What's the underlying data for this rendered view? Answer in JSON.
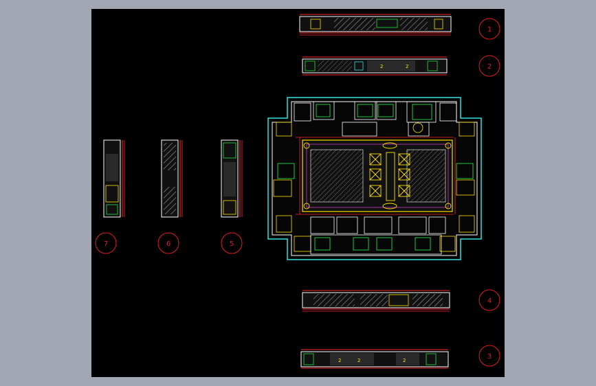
{
  "colors": {
    "background": "#a3a7b3",
    "viewport": "#000000",
    "marker": "#e02020",
    "dimension": "#ff2a2a",
    "wall": "#ffffff",
    "furniture": "#ffe000",
    "greenery": "#22e040",
    "outline": "#30e0e0",
    "magenta": "#e040e0"
  },
  "markers": [
    {
      "id": "1",
      "label": "1"
    },
    {
      "id": "2",
      "label": "2"
    },
    {
      "id": "3",
      "label": "3"
    },
    {
      "id": "4",
      "label": "4"
    },
    {
      "id": "5",
      "label": "5"
    },
    {
      "id": "6",
      "label": "6"
    },
    {
      "id": "7",
      "label": "7"
    }
  ]
}
